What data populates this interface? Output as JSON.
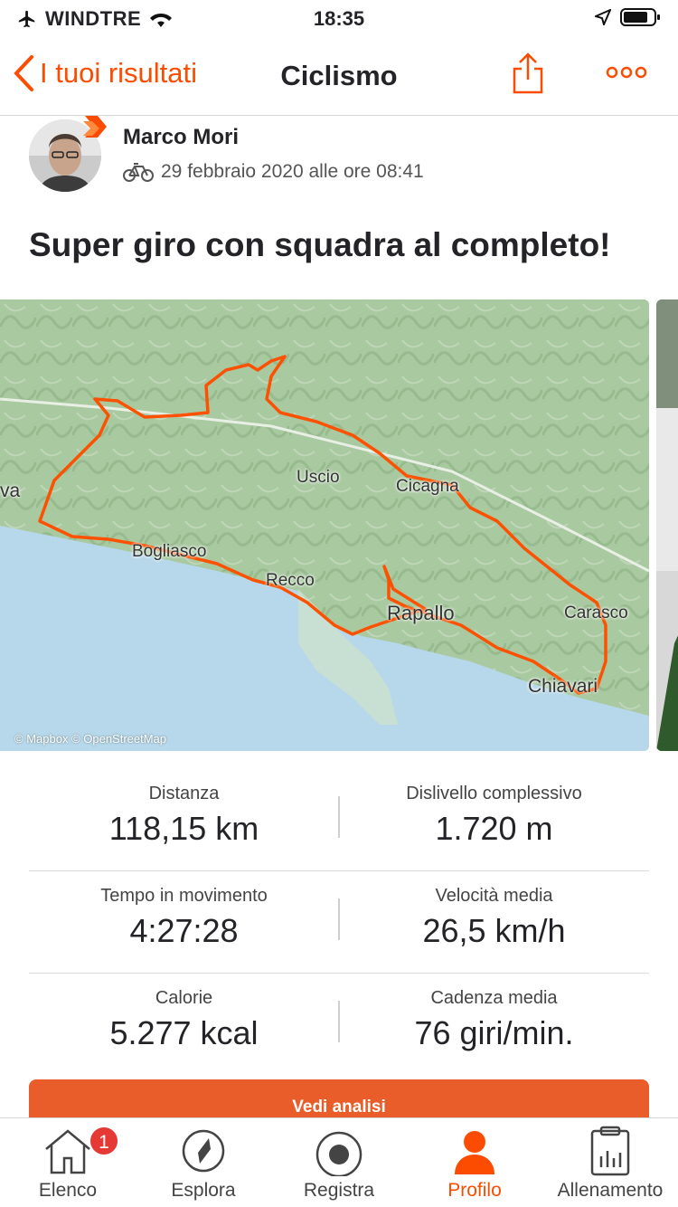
{
  "status_bar": {
    "carrier": "WINDTRE",
    "time": "18:35"
  },
  "nav": {
    "back_label": "I tuoi risultati",
    "title": "Ciclismo"
  },
  "athlete": {
    "name": "Marco Mori",
    "date": "29 febbraio 2020 alle ore 08:41"
  },
  "activity": {
    "title": "Super giro con squadra al completo!"
  },
  "map": {
    "labels": [
      "Uscio",
      "Cicagna",
      "Bogliasco",
      "Recco",
      "Rapallo",
      "Carasco",
      "Chiavari",
      "va"
    ],
    "credit": "© Mapbox © OpenStreetMap",
    "route_color": "#fc5200"
  },
  "stats": [
    {
      "label": "Distanza",
      "value": "118,15 km"
    },
    {
      "label": "Dislivello complessivo",
      "value": "1.720 m"
    },
    {
      "label": "Tempo in movimento",
      "value": "4:27:28"
    },
    {
      "label": "Velocità media",
      "value": "26,5 km/h"
    },
    {
      "label": "Calorie",
      "value": "5.277 kcal"
    },
    {
      "label": "Cadenza media",
      "value": "76 giri/min."
    }
  ],
  "cta_label": "Vedi analisi",
  "tabs": [
    {
      "label": "Elenco",
      "icon": "home-icon",
      "badge": "1"
    },
    {
      "label": "Esplora",
      "icon": "compass-icon"
    },
    {
      "label": "Registra",
      "icon": "record-icon"
    },
    {
      "label": "Profilo",
      "icon": "profile-icon"
    },
    {
      "label": "Allenamento",
      "icon": "training-plan-icon"
    }
  ],
  "colors": {
    "accent": "#fc4c02",
    "cta": "#e85d29",
    "badge": "#e53935"
  }
}
